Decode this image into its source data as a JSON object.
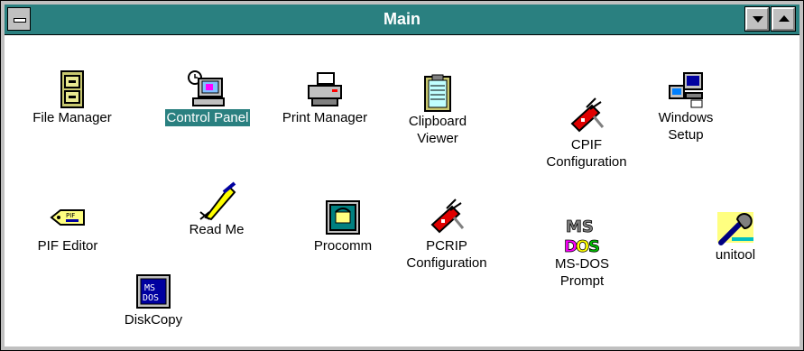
{
  "window": {
    "title": "Main"
  },
  "program_items": [
    {
      "id": "file-manager",
      "label": "File Manager",
      "icon": "file-cabinet-icon"
    },
    {
      "id": "control-panel",
      "label": "Control Panel",
      "icon": "computer-clock-icon",
      "selected": true
    },
    {
      "id": "print-manager",
      "label": "Print Manager",
      "icon": "printer-icon"
    },
    {
      "id": "clipboard-viewer",
      "label": "Clipboard\nViewer",
      "icon": "clipboard-icon"
    },
    {
      "id": "cpif-configuration",
      "label": "CPIF\nConfiguration",
      "icon": "swiss-knife-icon"
    },
    {
      "id": "windows-setup",
      "label": "Windows\nSetup",
      "icon": "computer-setup-icon"
    },
    {
      "id": "pif-editor",
      "label": "PIF Editor",
      "icon": "pif-tag-icon"
    },
    {
      "id": "read-me",
      "label": "Read Me",
      "icon": "pen-nib-icon"
    },
    {
      "id": "procomm",
      "label": "Procomm",
      "icon": "telephone-window-icon"
    },
    {
      "id": "pcrip-configuration",
      "label": "PCRIP\nConfiguration",
      "icon": "swiss-knife-icon"
    },
    {
      "id": "ms-dos-prompt",
      "label": "MS-DOS\nPrompt",
      "icon": "ms-dos-logo-icon"
    },
    {
      "id": "unitool",
      "label": "unitool",
      "icon": "wrench-icon"
    },
    {
      "id": "diskcopy",
      "label": "DiskCopy",
      "icon": "ms-dos-disk-icon"
    }
  ],
  "colors": {
    "titlebar": "#2a8080",
    "selection": "#2a8080",
    "frame": "#c0c0c0"
  }
}
